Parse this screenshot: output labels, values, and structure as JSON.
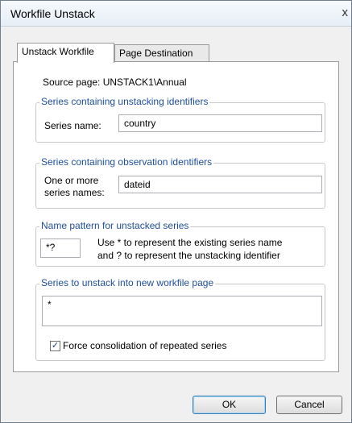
{
  "window": {
    "title": "Workfile Unstack",
    "close_glyph": "x"
  },
  "tabs": [
    {
      "label": "Unstack Workfile",
      "active": true
    },
    {
      "label": "Page Destination",
      "active": false
    }
  ],
  "source_page": "Source page: UNSTACK1\\Annual",
  "group_unstacking": {
    "legend": "Series containing unstacking identifiers",
    "label": "Series name:",
    "value": "country"
  },
  "group_observation": {
    "legend": "Series containing observation identifiers",
    "label_line1": "One or more",
    "label_line2": "series names:",
    "value": "dateid"
  },
  "group_pattern": {
    "legend": "Name pattern for unstacked series",
    "value": "*?",
    "help_line1": "Use * to represent the existing series name",
    "help_line2": "and ? to represent the unstacking identifier"
  },
  "group_series": {
    "legend": "Series to unstack into new workfile page",
    "value": "*",
    "checkbox_label": "Force consolidation of repeated series",
    "checkbox_checked": true,
    "checkbox_glyph": "✓"
  },
  "buttons": {
    "ok": "OK",
    "cancel": "Cancel"
  },
  "icons": [
    "close-icon",
    "checkmark-icon"
  ]
}
